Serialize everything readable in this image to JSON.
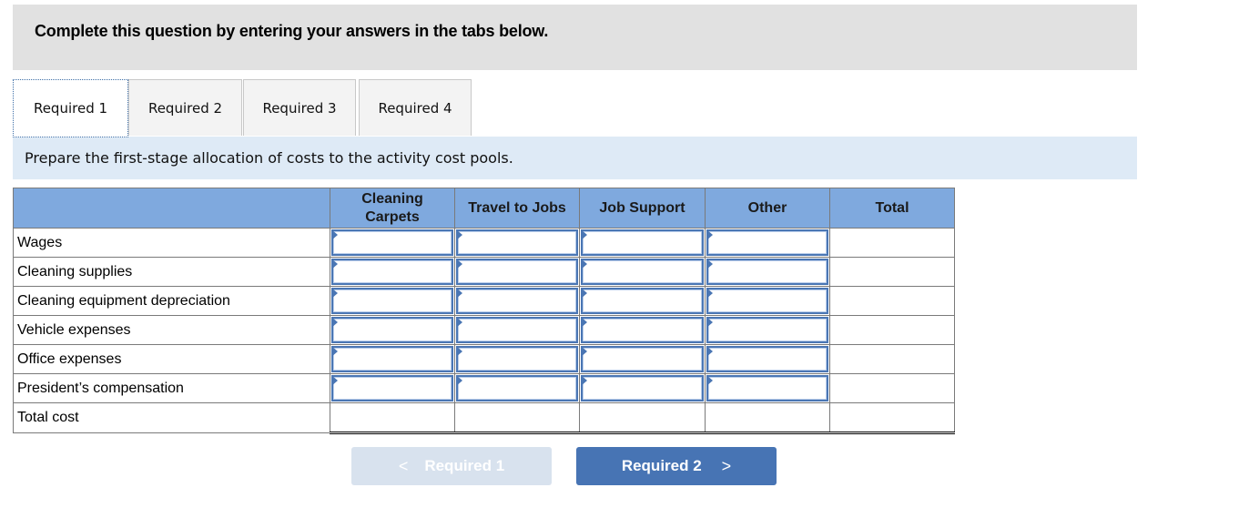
{
  "banner": {
    "text": "Complete this question by entering your answers in the tabs below."
  },
  "tabs": [
    {
      "label": "Required 1",
      "active": true
    },
    {
      "label": "Required 2",
      "active": false
    },
    {
      "label": "Required 3",
      "active": false
    },
    {
      "label": "Required 4",
      "active": false
    }
  ],
  "instruction": "Prepare the first-stage allocation of costs to the activity cost pools.",
  "table": {
    "columns": [
      "",
      "Cleaning Carpets",
      "Travel to Jobs",
      "Job Support",
      "Other",
      "Total"
    ],
    "column_lines": {
      "cleaning_1": "Cleaning",
      "cleaning_2": "Carpets"
    },
    "rows": [
      {
        "label": "Wages",
        "values": [
          "",
          "",
          "",
          "",
          ""
        ]
      },
      {
        "label": "Cleaning supplies",
        "values": [
          "",
          "",
          "",
          "",
          ""
        ]
      },
      {
        "label": "Cleaning equipment depreciation",
        "values": [
          "",
          "",
          "",
          "",
          ""
        ]
      },
      {
        "label": "Vehicle expenses",
        "values": [
          "",
          "",
          "",
          "",
          ""
        ]
      },
      {
        "label": "Office expenses",
        "values": [
          "",
          "",
          "",
          "",
          ""
        ]
      },
      {
        "label": "President’s compensation",
        "values": [
          "",
          "",
          "",
          "",
          ""
        ]
      }
    ],
    "total_row": {
      "label": "Total cost",
      "values": [
        "",
        "",
        "",
        "",
        ""
      ]
    }
  },
  "nav": {
    "prev": {
      "label": "Required 1",
      "icon": "chevron-left-icon",
      "glyph": "<",
      "enabled": false
    },
    "next": {
      "label": "Required 2",
      "icon": "chevron-right-icon",
      "glyph": ">",
      "enabled": true
    }
  },
  "colors": {
    "header_blue": "#7fa9de",
    "input_border": "#4a76b4",
    "next_button": "#4774b4",
    "prev_button_disabled": "#d8e2ee",
    "instruction_bg": "#deeaf6",
    "banner_bg": "#e1e1e1"
  }
}
